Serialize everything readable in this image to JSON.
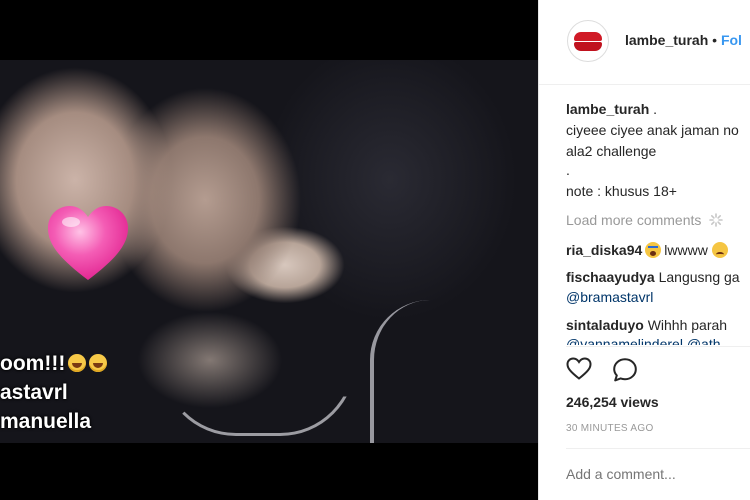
{
  "video": {
    "overlay_lines": [
      "oom!!!",
      "astavrl",
      "manuella"
    ],
    "heart_color": "#f04fa8"
  },
  "post": {
    "header": {
      "username": "lambe_turah",
      "separator": "•",
      "follow_label": "Fol"
    },
    "caption": {
      "username": "lambe_turah",
      "lines": [
        ".",
        "ciyeee ciyee anak jaman no",
        "ala2 challenge",
        ".",
        "note : khusus 18+"
      ]
    },
    "load_more_label": "Load more comments",
    "comments": [
      {
        "user": "ria_diska94",
        "text": "lwwww",
        "line2": ""
      },
      {
        "user": "fischaayudya",
        "text": "Langusng ga",
        "line2": "@bramastavrl"
      },
      {
        "user": "sintaladuyo",
        "text": "Wihhh parah",
        "line2": "@vannamelinderel @ath"
      }
    ],
    "views": "246,254 views",
    "timestamp": "30 MINUTES AGO",
    "add_comment_placeholder": "Add a comment...",
    "icons": {
      "like": "heart-outline-icon",
      "comment": "speech-bubble-icon",
      "loading": "spinner-icon"
    },
    "colors": {
      "text": "#262626",
      "muted": "#999999",
      "link": "#003569",
      "brand_red": "#d01a26"
    }
  }
}
